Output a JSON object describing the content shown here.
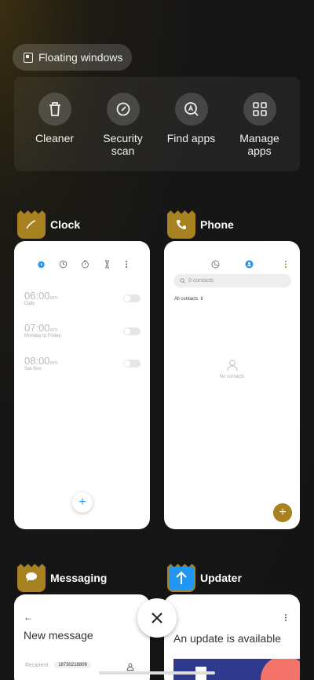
{
  "floating": {
    "label": "Floating windows"
  },
  "tools": [
    {
      "label": "Cleaner",
      "icon": "trash-icon"
    },
    {
      "label": "Security\nscan",
      "icon": "shield-check-icon"
    },
    {
      "label": "Find apps",
      "icon": "search-apps-icon"
    },
    {
      "label": "Manage\napps",
      "icon": "grid-apps-icon"
    }
  ],
  "apps": {
    "clock": {
      "name": "Clock",
      "alarms": [
        {
          "time": "06:00",
          "ampm": "am",
          "repeat": "Daily"
        },
        {
          "time": "07:00",
          "ampm": "am",
          "repeat": "Monday to Friday"
        },
        {
          "time": "08:00",
          "ampm": "am",
          "repeat": "Sat-Sun"
        }
      ],
      "add": "+"
    },
    "phone": {
      "name": "Phone",
      "search_placeholder": "0 contacts",
      "filter": "All contacts",
      "empty": "No contacts",
      "add": "+"
    },
    "messaging": {
      "name": "Messaging",
      "title": "New message",
      "recipient_label": "Recipient",
      "recipient": "18730218809"
    },
    "updater": {
      "name": "Updater",
      "message": "An update is available"
    }
  },
  "colors": {
    "accent_gold": "#a88220",
    "accent_blue": "#2196f3"
  }
}
